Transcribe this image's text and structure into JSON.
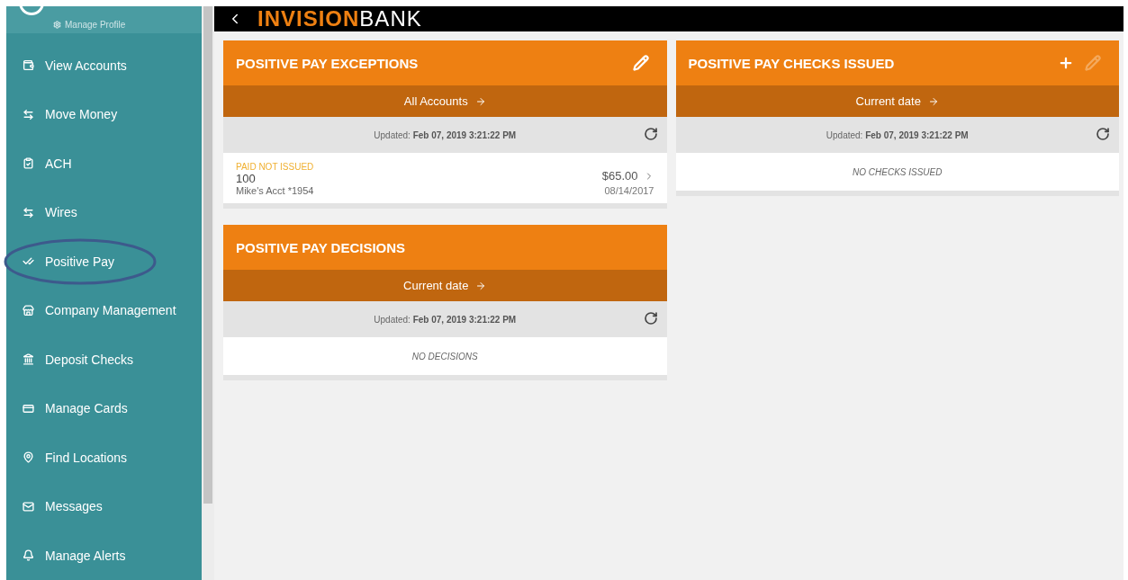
{
  "sidebar": {
    "profile": {
      "label": "Manage Profile"
    },
    "items": [
      {
        "label": "View Accounts",
        "circled": false
      },
      {
        "label": "Move Money",
        "circled": false
      },
      {
        "label": "ACH",
        "circled": false
      },
      {
        "label": "Wires",
        "circled": false
      },
      {
        "label": "Positive Pay",
        "circled": true
      },
      {
        "label": "Company Management",
        "circled": false
      },
      {
        "label": "Deposit Checks",
        "circled": false
      },
      {
        "label": "Manage Cards",
        "circled": false
      },
      {
        "label": "Find Locations",
        "circled": false
      },
      {
        "label": "Messages",
        "circled": false
      },
      {
        "label": "Manage Alerts",
        "circled": false
      }
    ]
  },
  "header": {
    "logo_bold": "INVISION",
    "logo_light": "BANK"
  },
  "columns": [
    [
      {
        "title": "POSITIVE PAY EXCEPTIONS",
        "actions": [
          {
            "kind": "edit",
            "disabled": false
          }
        ],
        "filter": "All Accounts",
        "updated_label": "Updated:",
        "updated_value": "Feb 07, 2019 3:21:22 PM",
        "rows": [
          {
            "status": "PAID NOT ISSUED",
            "number": "100",
            "account": "Mike's Acct *1954",
            "amount": "$65.00",
            "date": "08/14/2017"
          }
        ]
      },
      {
        "title": "POSITIVE PAY DECISIONS",
        "filter": "Current date",
        "updated_label": "Updated:",
        "updated_value": "Feb 07, 2019 3:21:22 PM",
        "empty": "NO DECISIONS"
      }
    ],
    [
      {
        "title": "POSITIVE PAY CHECKS ISSUED",
        "actions": [
          {
            "kind": "add",
            "disabled": false
          },
          {
            "kind": "edit",
            "disabled": true
          }
        ],
        "filter": "Current date",
        "updated_label": "Updated:",
        "updated_value": "Feb 07, 2019 3:21:22 PM",
        "empty": "NO CHECKS ISSUED"
      }
    ]
  ]
}
